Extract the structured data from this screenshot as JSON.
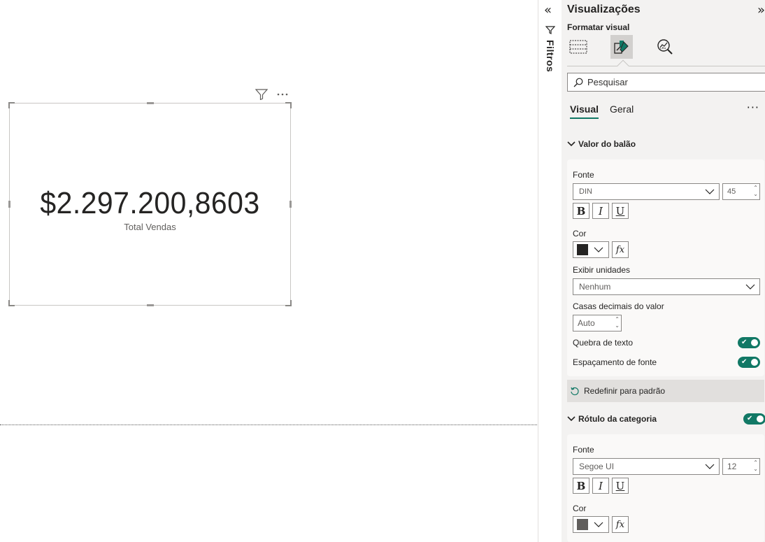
{
  "card": {
    "value": "$2.297.200,8603",
    "label": "Total Vendas"
  },
  "filters_pane": {
    "label": "Filtros"
  },
  "viz_pane": {
    "title": "Visualizações",
    "format_title": "Formatar visual",
    "search_placeholder": "Pesquisar",
    "tabs": [
      {
        "label": "Visual"
      },
      {
        "label": "Geral"
      }
    ],
    "active_tab": "Visual",
    "callout_section": {
      "title": "Valor do balão",
      "font_label": "Fonte",
      "font_family": "DIN",
      "font_size": "45",
      "bold": "B",
      "italic": "I",
      "underline": "U",
      "color_label": "Cor",
      "color": "#252423",
      "fx": "fx",
      "display_units_label": "Exibir unidades",
      "display_units_value": "Nenhum",
      "decimals_label": "Casas decimais do valor",
      "decimals_value": "Auto",
      "text_wrap_label": "Quebra de texto",
      "text_wrap_on": true,
      "font_spacing_label": "Espaçamento de fonte",
      "font_spacing_on": true,
      "reset_label": "Redefinir para padrão"
    },
    "category_section": {
      "title": "Rótulo da categoria",
      "enabled": true,
      "font_label": "Fonte",
      "font_family": "Segoe UI",
      "font_size": "12",
      "bold": "B",
      "italic": "I",
      "underline": "U",
      "color_label": "Cor",
      "color": "#605e5c",
      "fx": "fx"
    }
  },
  "colors": {
    "accent": "#117865",
    "pane_bg": "#f3f2f1",
    "card_text": "#252423"
  }
}
